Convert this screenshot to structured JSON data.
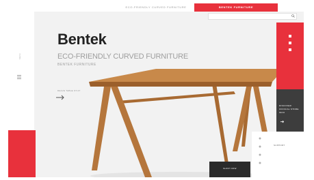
{
  "topbar": {
    "tab_1": "ECO-FRIENDLY CURVED FURNITURE",
    "tab_2": "BENTEK FURNITURE"
  },
  "rail": {
    "vertical_text": "MENU"
  },
  "hero": {
    "brand": "Bentek",
    "tagline": "ECO-FRIENDLY CURVED FURNITURE",
    "subtag": "BENTEK FURNITURE",
    "link": "DELVE TABLE ST-07"
  },
  "panel": {
    "text": "DISCOVER OFFICIAL STORE INFO"
  },
  "card": {
    "label": "SUPPORT"
  },
  "cta": {
    "label": "SHOP NOW"
  },
  "colors": {
    "accent": "#e8313c",
    "dark": "#3d3d3d",
    "wood": "#b5763c"
  }
}
